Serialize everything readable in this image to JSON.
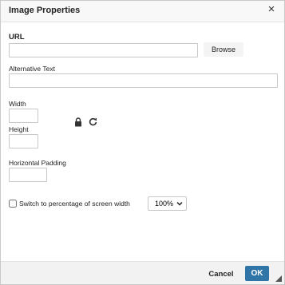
{
  "dialog": {
    "title": "Image Properties",
    "close_icon": "close-icon"
  },
  "url_field": {
    "label": "URL",
    "value": "",
    "placeholder": ""
  },
  "browse_button": {
    "label": "Browse"
  },
  "alt_text_field": {
    "label": "Alternative Text",
    "value": ""
  },
  "width_field": {
    "label": "Width",
    "value": ""
  },
  "height_field": {
    "label": "Height",
    "value": ""
  },
  "aspect_controls": {
    "lock_icon": "lock-icon",
    "reset_icon": "reset-size-icon"
  },
  "padding_field": {
    "label": "Horizontal Padding",
    "value": ""
  },
  "percentage_option": {
    "label": "Switch to percentage of screen width",
    "checked": false,
    "selected_value": "100%",
    "chevron_icon": "chevron-down-icon"
  },
  "footer": {
    "cancel_label": "Cancel",
    "ok_label": "OK"
  },
  "colors": {
    "primary_button": "#2f75a8",
    "header_background": "#f8f8f8",
    "footer_background": "#f2f2f2"
  }
}
